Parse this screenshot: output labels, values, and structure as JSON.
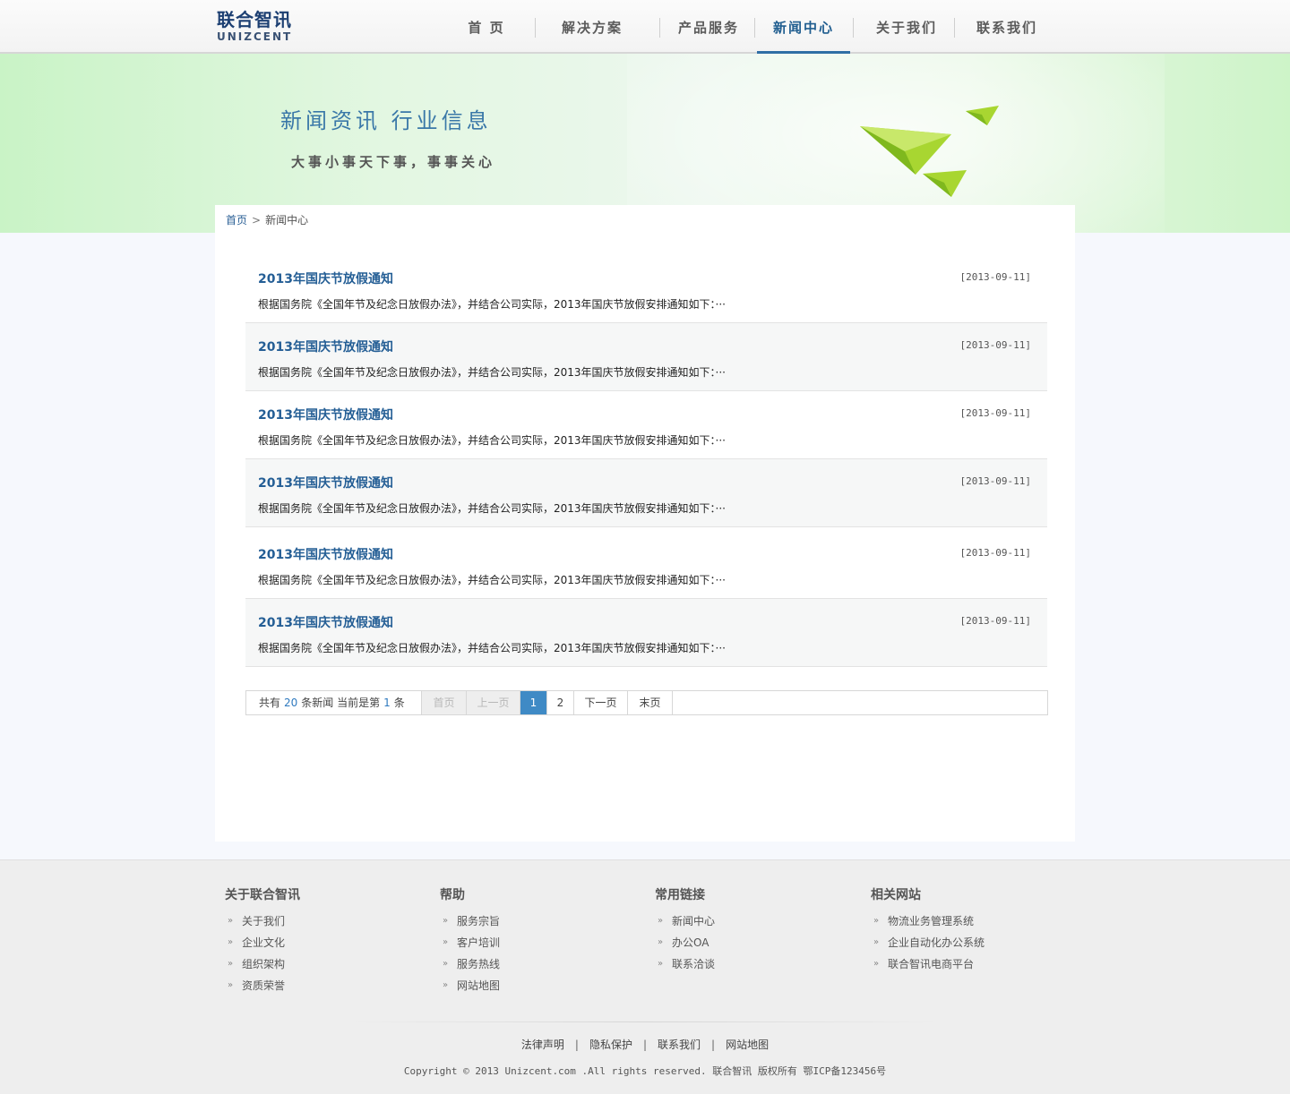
{
  "header": {
    "logo_cn": "联合智讯",
    "logo_en": "UNIZCENT",
    "nav": [
      {
        "label": "首 页"
      },
      {
        "label": "解决方案"
      },
      {
        "label": "产品服务"
      },
      {
        "label": "新闻中心",
        "active": true
      },
      {
        "label": "关于我们"
      },
      {
        "label": "联系我们"
      }
    ]
  },
  "banner": {
    "title": "新闻资讯 行业信息",
    "subtitle": "大事小事天下事，事事关心"
  },
  "breadcrumb": {
    "home": "首页",
    "separator": ">",
    "current": "新闻中心"
  },
  "news": [
    {
      "title": "2013年国庆节放假通知",
      "date": "[2013-09-11]",
      "summary": "根据国务院《全国年节及纪念日放假办法》，并结合公司实际，2013年国庆节放假安排通知如下：···"
    },
    {
      "title": "2013年国庆节放假通知",
      "date": "[2013-09-11]",
      "summary": "根据国务院《全国年节及纪念日放假办法》，并结合公司实际，2013年国庆节放假安排通知如下：···"
    },
    {
      "title": "2013年国庆节放假通知",
      "date": "[2013-09-11]",
      "summary": "根据国务院《全国年节及纪念日放假办法》，并结合公司实际，2013年国庆节放假安排通知如下：···"
    },
    {
      "title": "2013年国庆节放假通知",
      "date": "[2013-09-11]",
      "summary": "根据国务院《全国年节及纪念日放假办法》，并结合公司实际，2013年国庆节放假安排通知如下：···"
    },
    {
      "title": "2013年国庆节放假通知",
      "date": "[2013-09-11]",
      "summary": "根据国务院《全国年节及纪念日放假办法》，并结合公司实际，2013年国庆节放假安排通知如下：···"
    },
    {
      "title": "2013年国庆节放假通知",
      "date": "[2013-09-11]",
      "summary": "根据国务院《全国年节及纪念日放假办法》，并结合公司实际，2013年国庆节放假安排通知如下：···"
    }
  ],
  "pager": {
    "prefix": "共有",
    "total": "20",
    "middle": "条新闻 当前是第",
    "current_page": "1",
    "suffix": "条",
    "first": "首页",
    "prev": "上一页",
    "pages": [
      "1",
      "2"
    ],
    "next": "下一页",
    "last": "末页"
  },
  "footer": {
    "columns": [
      {
        "title": "关于联合智讯",
        "links": [
          "关于我们",
          "企业文化",
          "组织架构",
          "资质荣誉"
        ]
      },
      {
        "title": "帮助",
        "links": [
          "服务宗旨",
          "客户培训",
          "服务热线",
          "网站地图"
        ]
      },
      {
        "title": "常用链接",
        "links": [
          "新闻中心",
          "办公OA",
          "联系洽谈"
        ]
      },
      {
        "title": "相关网站",
        "links": [
          "物流业务管理系统",
          "企业自动化办公系统",
          "联合智讯电商平台"
        ]
      }
    ],
    "bottom_links": [
      "法律声明",
      "隐私保护",
      "联系我们",
      "网站地图"
    ],
    "link_separator": "|",
    "copyright": "Copyright © 2013  Unizcent.com .All rights reserved. 联合智讯 版权所有  鄂ICP备123456号"
  },
  "colors": {
    "brand": "#1c3f72",
    "link": "#245e95",
    "active_page": "#3f8ac5",
    "banner_green": "#c9f3c6"
  },
  "icons": {
    "breadcrumb_arrow": "chevron-right-icon",
    "footer_bullet": "double-chevron-right-icon",
    "banner_decor": "paper-plane-icon"
  }
}
